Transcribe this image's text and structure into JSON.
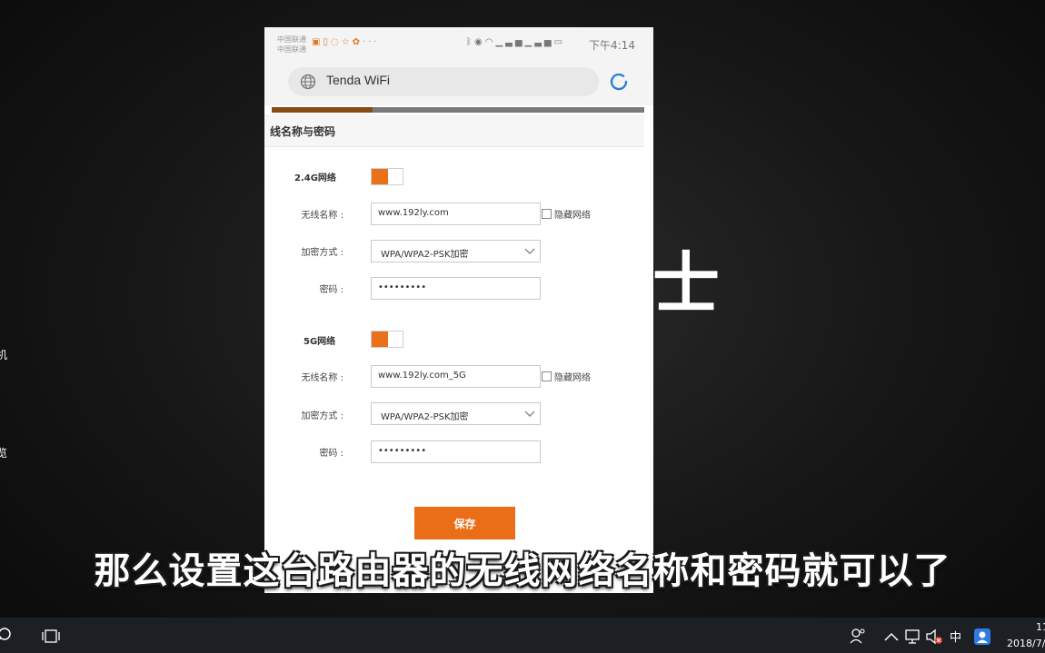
{
  "background": {
    "left_text_1": "机",
    "left_text_2": "览",
    "right_text": "士"
  },
  "phone": {
    "status_bar": {
      "carrier_1": "中国联通",
      "carrier_2": "中国联通",
      "time": "下午4:14"
    },
    "address_bar": {
      "url": "Tenda WiFi"
    },
    "progress_fraction": 0.27,
    "section_title": "线名称与密码",
    "networks": [
      {
        "title": "2.4G网络",
        "enabled": true,
        "ssid_label": "无线名称 :",
        "ssid_value": "www.192ly.com",
        "hide_label": "隐藏网络",
        "security_label": "加密方式 :",
        "security_value": "WPA/WPA2-PSK加密",
        "password_label": "密码 :",
        "password_value": "•••••••••"
      },
      {
        "title": "5G网络",
        "enabled": true,
        "ssid_label": "无线名称 :",
        "ssid_value": "www.192ly.com_5G",
        "hide_label": "隐藏网络",
        "security_label": "加密方式 :",
        "security_value": "WPA/WPA2-PSK加密",
        "password_label": "密码 :",
        "password_value": "•••••••••"
      }
    ],
    "save_label": "保存"
  },
  "subtitle": "那么设置这台路由器的无线网络名称和密码就可以了",
  "taskbar": {
    "ime": "中",
    "clock_time": "11",
    "clock_date": "2018/7/"
  },
  "colors": {
    "accent": "#ea6e18",
    "progress_fill": "#8a4a14",
    "taskbar": "#1c1f24"
  }
}
